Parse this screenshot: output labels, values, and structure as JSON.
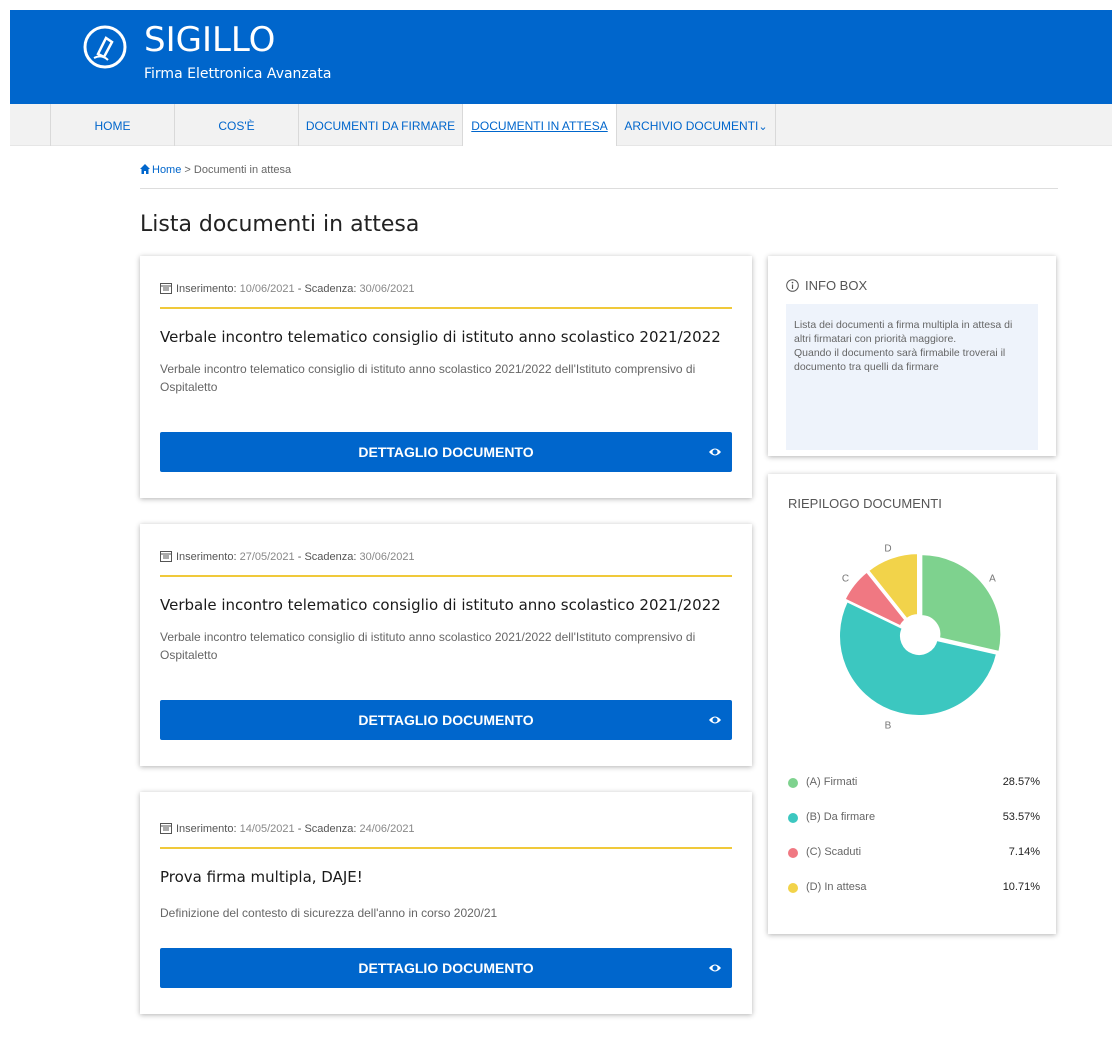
{
  "app": {
    "title": "SIGILLO",
    "subtitle": "Firma Elettronica Avanzata"
  },
  "nav": {
    "items": [
      {
        "label": "HOME"
      },
      {
        "label": "COS'È"
      },
      {
        "label": "DOCUMENTI DA FIRMARE"
      },
      {
        "label": "DOCUMENTI IN ATTESA",
        "active": true
      },
      {
        "label": "ARCHIVIO DOCUMENTI"
      }
    ]
  },
  "breadcrumb": {
    "home": "Home",
    "separator": ">",
    "current": "Documenti in attesa"
  },
  "page": {
    "title": "Lista documenti in attesa"
  },
  "cards": [
    {
      "inserimento_label": "Inserimento:",
      "inserimento": "10/06/2021",
      "dash": "-",
      "scadenza_label": "Scadenza:",
      "scadenza": "30/06/2021",
      "title": "Verbale incontro telematico consiglio di istituto anno scolastico 2021/2022",
      "description": "Verbale incontro telematico consiglio di istituto anno scolastico 2021/2022 dell'Istituto comprensivo di Ospitaletto",
      "button": "DETTAGLIO DOCUMENTO"
    },
    {
      "inserimento_label": "Inserimento:",
      "inserimento": "27/05/2021",
      "dash": "-",
      "scadenza_label": "Scadenza:",
      "scadenza": "30/06/2021",
      "title": "Verbale incontro telematico consiglio di istituto anno scolastico 2021/2022",
      "description": "Verbale incontro telematico consiglio di istituto anno scolastico 2021/2022 dell'Istituto comprensivo di Ospitaletto",
      "button": "DETTAGLIO DOCUMENTO"
    },
    {
      "inserimento_label": "Inserimento:",
      "inserimento": "14/05/2021",
      "dash": "-",
      "scadenza_label": "Scadenza:",
      "scadenza": "24/06/2021",
      "title": "Prova firma multipla, DAJE!",
      "description": "Definizione del contesto di sicurezza dell'anno in corso 2020/21",
      "button": "DETTAGLIO DOCUMENTO"
    }
  ],
  "infobox": {
    "title": "INFO BOX",
    "line1": "Lista dei documenti a firma multipla in attesa di altri firmatari con priorità maggiore.",
    "line2": "Quando il documento sarà firmabile troverai il documento tra quelli da firmare"
  },
  "summary": {
    "title": "RIEPILOGO DOCUMENTI"
  },
  "chart_data": {
    "type": "pie",
    "categories": [
      "A",
      "B",
      "C",
      "D"
    ],
    "values": [
      28.57,
      53.57,
      7.14,
      10.71
    ],
    "colors": [
      "#7ed28e",
      "#3cc7c0",
      "#f07882",
      "#f2d34a"
    ],
    "legend": [
      {
        "label": "(A) Firmati",
        "value": "28.57%"
      },
      {
        "label": "(B) Da firmare",
        "value": "53.57%"
      },
      {
        "label": "(C) Scaduti",
        "value": "7.14%"
      },
      {
        "label": "(D) In attesa",
        "value": "10.71%"
      }
    ]
  }
}
